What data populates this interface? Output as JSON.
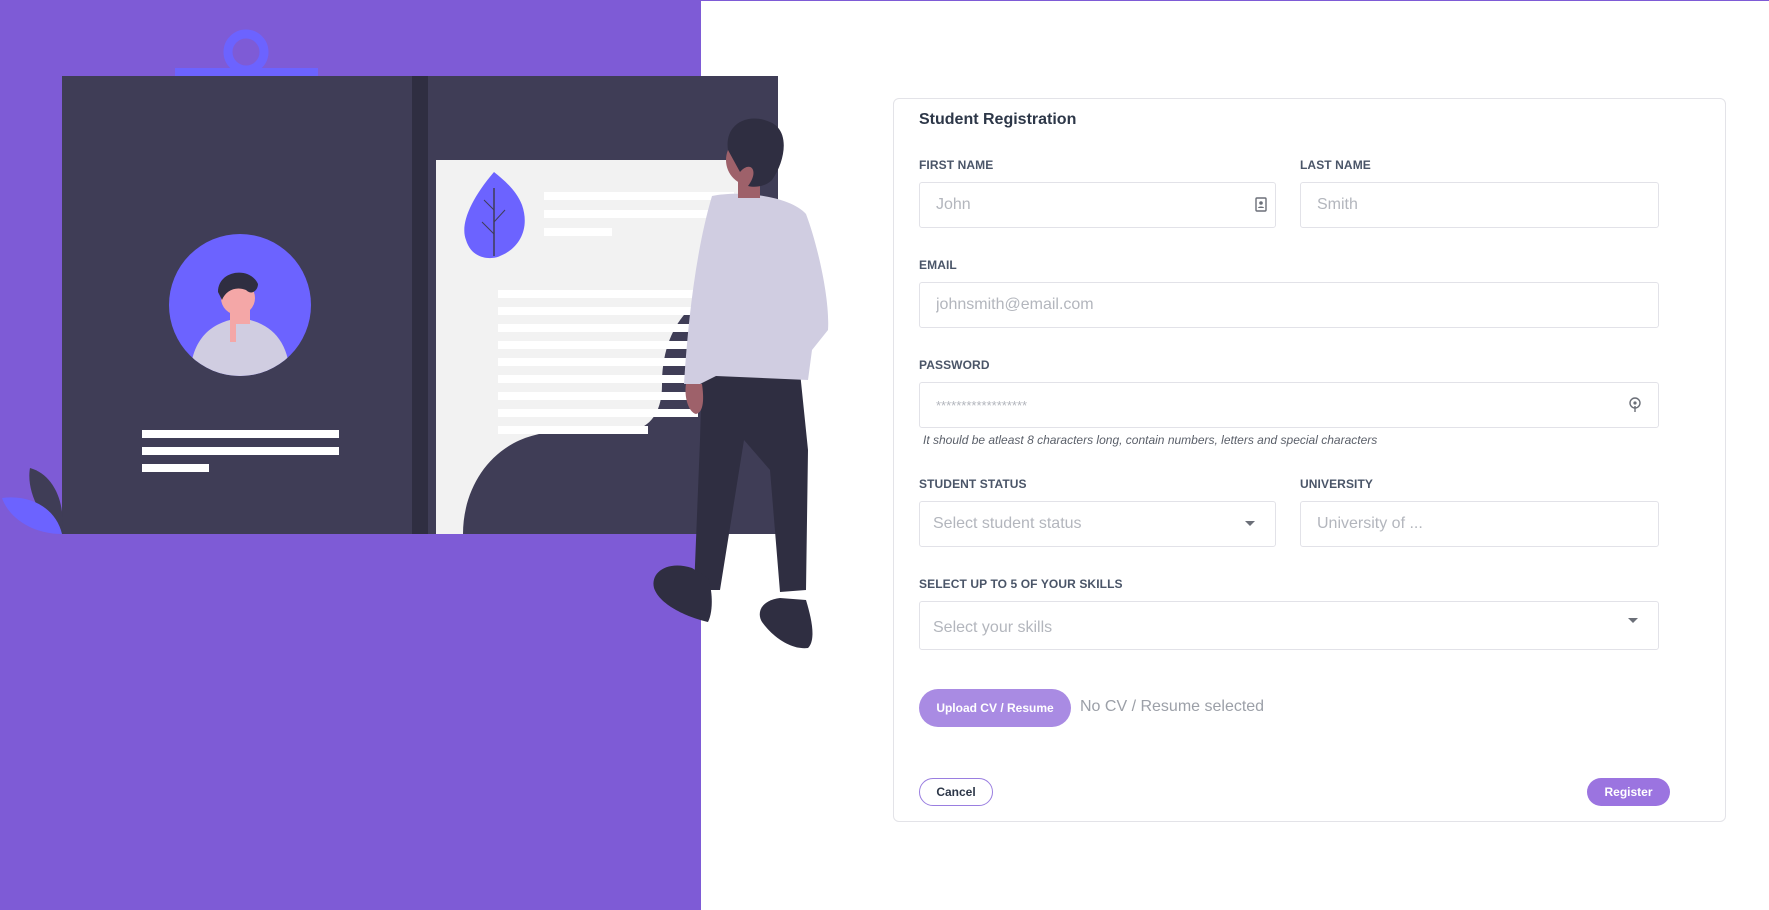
{
  "form": {
    "title": "Student Registration",
    "first_name": {
      "label": "FIRST NAME",
      "placeholder": "John",
      "value": ""
    },
    "last_name": {
      "label": "LAST NAME",
      "placeholder": "Smith",
      "value": ""
    },
    "email": {
      "label": "EMAIL",
      "placeholder": "johnsmith@email.com",
      "value": ""
    },
    "password": {
      "label": "PASSWORD",
      "placeholder": "******************",
      "value": "",
      "hint": "It should be atleast 8 characters long, contain numbers, letters and special characters"
    },
    "student_status": {
      "label": "STUDENT STATUS",
      "placeholder": "Select student status"
    },
    "university": {
      "label": "UNIVERSITY",
      "placeholder": "University of ...",
      "value": ""
    },
    "skills": {
      "label": "SELECT UP TO 5 OF YOUR SKILLS",
      "placeholder": "Select your skills"
    },
    "upload": {
      "button_label": "Upload CV / Resume",
      "status": "No CV / Resume selected"
    },
    "cancel_label": "Cancel",
    "register_label": "Register"
  },
  "icons": {
    "contact_card": "contact-card-icon",
    "password_key": "key-icon",
    "dropdown": "chevron-down-icon"
  },
  "colors": {
    "brand_purple": "#7e5bd6",
    "button_purple": "#a98be3",
    "register_purple": "#9b74e0",
    "illustration_dark": "#3f3d56",
    "illustration_accent": "#6c63ff"
  }
}
